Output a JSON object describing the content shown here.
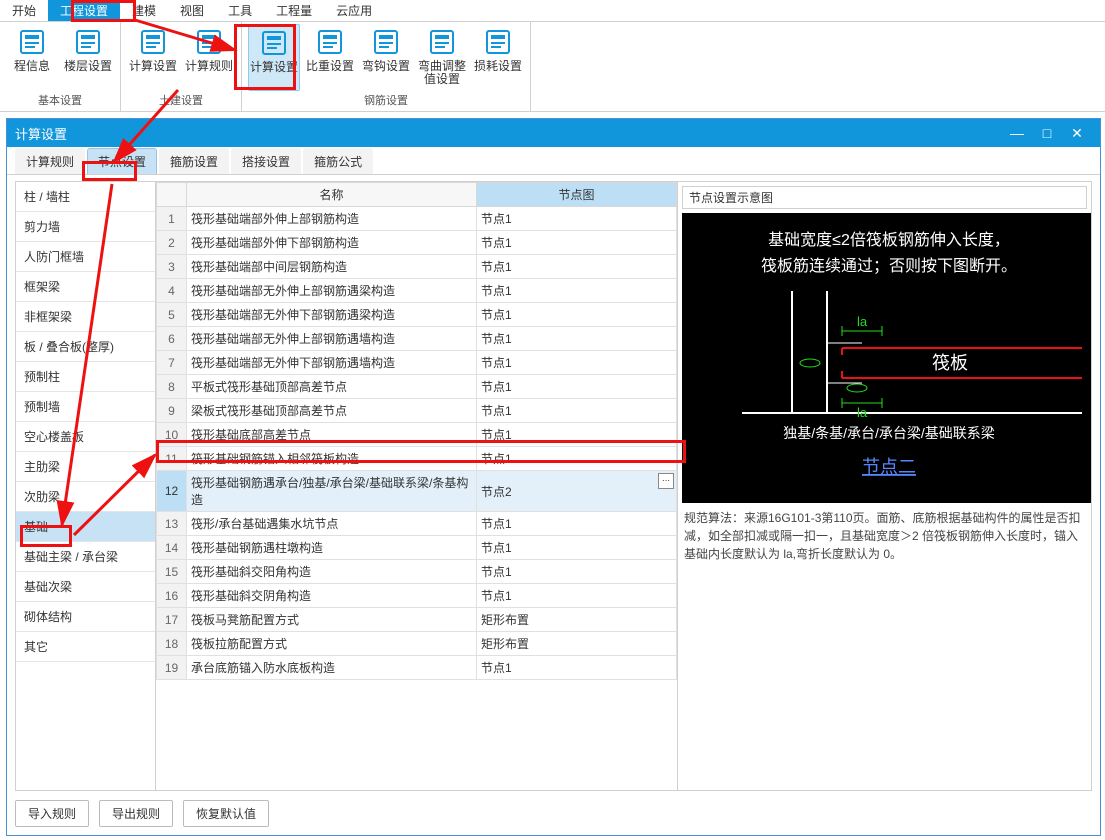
{
  "menu": [
    "开始",
    "工程设置",
    "建模",
    "视图",
    "工具",
    "工程量",
    "云应用"
  ],
  "menu_active": 1,
  "ribbon": {
    "groups": [
      {
        "label": "基本设置",
        "items": [
          {
            "l": "程信息"
          },
          {
            "l": "楼层设置"
          }
        ]
      },
      {
        "label": "土建设置",
        "items": [
          {
            "l": "计算设置"
          },
          {
            "l": "计算规则"
          }
        ]
      },
      {
        "label": "钢筋设置",
        "items": [
          {
            "l": "计算设置",
            "active": true
          },
          {
            "l": "比重设置"
          },
          {
            "l": "弯钩设置"
          },
          {
            "l": "弯曲调整值设置"
          },
          {
            "l": "损耗设置"
          }
        ]
      }
    ]
  },
  "dialog": {
    "title": "计算设置",
    "tabs": [
      "计算规则",
      "节点设置",
      "箍筋设置",
      "搭接设置",
      "箍筋公式"
    ],
    "tab_active": 1,
    "cats": [
      "柱 / 墙柱",
      "剪力墙",
      "人防门框墙",
      "框架梁",
      "非框架梁",
      "板 / 叠合板(整厚)",
      "预制柱",
      "预制墙",
      "空心楼盖板",
      "主肋梁",
      "次肋梁",
      "基础",
      "基础主梁 / 承台梁",
      "基础次梁",
      "砌体结构",
      "其它"
    ],
    "cat_sel": 11,
    "headers": {
      "name": "名称",
      "node": "节点图"
    },
    "rows": [
      {
        "n": 1,
        "name": "筏形基础端部外伸上部钢筋构造",
        "v": "节点1"
      },
      {
        "n": 2,
        "name": "筏形基础端部外伸下部钢筋构造",
        "v": "节点1"
      },
      {
        "n": 3,
        "name": "筏形基础端部中间层钢筋构造",
        "v": "节点1"
      },
      {
        "n": 4,
        "name": "筏形基础端部无外伸上部钢筋遇梁构造",
        "v": "节点1"
      },
      {
        "n": 5,
        "name": "筏形基础端部无外伸下部钢筋遇梁构造",
        "v": "节点1"
      },
      {
        "n": 6,
        "name": "筏形基础端部无外伸上部钢筋遇墙构造",
        "v": "节点1"
      },
      {
        "n": 7,
        "name": "筏形基础端部无外伸下部钢筋遇墙构造",
        "v": "节点1"
      },
      {
        "n": 8,
        "name": "平板式筏形基础顶部高差节点",
        "v": "节点1"
      },
      {
        "n": 9,
        "name": "梁板式筏形基础顶部高差节点",
        "v": "节点1"
      },
      {
        "n": 10,
        "name": "筏形基础底部高差节点",
        "v": "节点1"
      },
      {
        "n": 11,
        "name": "筏形基础钢筋锚入相邻筏板构造",
        "v": "节点1"
      },
      {
        "n": 12,
        "name": "筏形基础钢筋遇承台/独基/承台梁/基础联系梁/条基构造",
        "v": "节点2",
        "sel": true
      },
      {
        "n": 13,
        "name": "筏形/承台基础遇集水坑节点",
        "v": "节点1"
      },
      {
        "n": 14,
        "name": "筏形基础钢筋遇柱墩构造",
        "v": "节点1"
      },
      {
        "n": 15,
        "name": "筏形基础斜交阳角构造",
        "v": "节点1"
      },
      {
        "n": 16,
        "name": "筏形基础斜交阴角构造",
        "v": "节点1"
      },
      {
        "n": 17,
        "name": "筏板马凳筋配置方式",
        "v": "矩形布置"
      },
      {
        "n": 18,
        "name": "筏板拉筋配置方式",
        "v": "矩形布置"
      },
      {
        "n": 19,
        "name": "承台底筋锚入防水底板构造",
        "v": "节点1"
      }
    ],
    "diagram": {
      "title": "节点设置示意图",
      "line1": "基础宽度≤2倍筏板钢筋伸入长度，",
      "line2": "筏板筋连续通过；否则按下图断开。",
      "la": "la",
      "fb": "筏板",
      "sub": "独基/条基/承台/承台梁/基础联系梁",
      "link": "节点二",
      "desc": "规范算法：来源16G101-3第110页。面筋、底筋根据基础构件的属性是否扣减，如全部扣减或隔一扣一，且基础宽度＞2 倍筏板钢筋伸入长度时，锚入基础内长度默认为 la,弯折长度默认为 0。"
    },
    "buttons": [
      "导入规则",
      "导出规则",
      "恢复默认值"
    ]
  }
}
